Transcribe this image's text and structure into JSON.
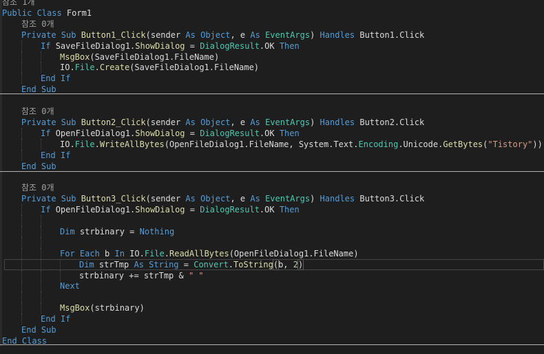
{
  "editor": {
    "theme_colors": {
      "background": "#1e1e1e",
      "plain": "#dcdcdc",
      "keyword": "#569cd6",
      "method": "#dcdcaa",
      "type": "#4ec9b0",
      "string": "#d69d85",
      "number": "#b5cea8",
      "reference_hint": "#a0a0a0"
    },
    "lines": [
      {
        "tokens": [
          {
            "t": "참조 1개",
            "c": "ref"
          }
        ]
      },
      {
        "tokens": [
          {
            "t": "Public Class ",
            "c": "kw"
          },
          {
            "t": "Form1",
            "c": "plain"
          }
        ]
      },
      {
        "tokens": [
          {
            "t": "참조 0개",
            "c": "ref"
          }
        ]
      },
      {
        "tokens": [
          {
            "t": "Private Sub ",
            "c": "kw"
          },
          {
            "t": "Button1_Click",
            "c": "method"
          },
          {
            "t": "(sender ",
            "c": "plain"
          },
          {
            "t": "As ",
            "c": "kw"
          },
          {
            "t": "Object",
            "c": "kw"
          },
          {
            "t": ", e ",
            "c": "plain"
          },
          {
            "t": "As ",
            "c": "kw"
          },
          {
            "t": "EventArgs",
            "c": "type"
          },
          {
            "t": ") ",
            "c": "plain"
          },
          {
            "t": "Handles ",
            "c": "kw"
          },
          {
            "t": "Button1.Click",
            "c": "plain"
          }
        ]
      },
      {
        "tokens": [
          {
            "t": "If ",
            "c": "kw"
          },
          {
            "t": "SaveFileDialog1.",
            "c": "plain"
          },
          {
            "t": "ShowDialog",
            "c": "method"
          },
          {
            "t": " = ",
            "c": "plain"
          },
          {
            "t": "DialogResult",
            "c": "type"
          },
          {
            "t": ".OK ",
            "c": "plain"
          },
          {
            "t": "Then",
            "c": "kw"
          }
        ]
      },
      {
        "tokens": [
          {
            "t": "MsgBox",
            "c": "method"
          },
          {
            "t": "(SaveFileDialog1.FileName)",
            "c": "plain"
          }
        ]
      },
      {
        "tokens": [
          {
            "t": "IO.",
            "c": "plain"
          },
          {
            "t": "File",
            "c": "type"
          },
          {
            "t": ".",
            "c": "plain"
          },
          {
            "t": "Create",
            "c": "method"
          },
          {
            "t": "(SaveFileDialog1.FileName)",
            "c": "plain"
          }
        ]
      },
      {
        "tokens": [
          {
            "t": "End If",
            "c": "kw"
          }
        ]
      },
      {
        "tokens": [
          {
            "t": "End Sub",
            "c": "kw"
          }
        ]
      },
      {
        "tokens": []
      },
      {
        "tokens": [
          {
            "t": "참조 0개",
            "c": "ref"
          }
        ]
      },
      {
        "tokens": [
          {
            "t": "Private Sub ",
            "c": "kw"
          },
          {
            "t": "Button2_Click",
            "c": "method"
          },
          {
            "t": "(sender ",
            "c": "plain"
          },
          {
            "t": "As ",
            "c": "kw"
          },
          {
            "t": "Object",
            "c": "kw"
          },
          {
            "t": ", e ",
            "c": "plain"
          },
          {
            "t": "As ",
            "c": "kw"
          },
          {
            "t": "EventArgs",
            "c": "type"
          },
          {
            "t": ") ",
            "c": "plain"
          },
          {
            "t": "Handles ",
            "c": "kw"
          },
          {
            "t": "Button2.Click",
            "c": "plain"
          }
        ]
      },
      {
        "tokens": [
          {
            "t": "If ",
            "c": "kw"
          },
          {
            "t": "OpenFileDialog1.",
            "c": "plain"
          },
          {
            "t": "ShowDialog",
            "c": "method"
          },
          {
            "t": " = ",
            "c": "plain"
          },
          {
            "t": "DialogResult",
            "c": "type"
          },
          {
            "t": ".OK ",
            "c": "plain"
          },
          {
            "t": "Then",
            "c": "kw"
          }
        ]
      },
      {
        "tokens": [
          {
            "t": "IO.",
            "c": "plain"
          },
          {
            "t": "File",
            "c": "type"
          },
          {
            "t": ".",
            "c": "plain"
          },
          {
            "t": "WriteAllBytes",
            "c": "method"
          },
          {
            "t": "(OpenFileDialog1.FileName, System.Text.",
            "c": "plain"
          },
          {
            "t": "Encoding",
            "c": "type"
          },
          {
            "t": ".Unicode.",
            "c": "plain"
          },
          {
            "t": "GetBytes",
            "c": "method"
          },
          {
            "t": "(",
            "c": "plain"
          },
          {
            "t": "\"Tistory\"",
            "c": "str"
          },
          {
            "t": "))",
            "c": "plain"
          }
        ]
      },
      {
        "tokens": [
          {
            "t": "End If",
            "c": "kw"
          }
        ]
      },
      {
        "tokens": [
          {
            "t": "End Sub",
            "c": "kw"
          }
        ]
      },
      {
        "tokens": []
      },
      {
        "tokens": [
          {
            "t": "참조 0개",
            "c": "ref"
          }
        ]
      },
      {
        "tokens": [
          {
            "t": "Private Sub ",
            "c": "kw"
          },
          {
            "t": "Button3_Click",
            "c": "method"
          },
          {
            "t": "(sender ",
            "c": "plain"
          },
          {
            "t": "As ",
            "c": "kw"
          },
          {
            "t": "Object",
            "c": "kw"
          },
          {
            "t": ", e ",
            "c": "plain"
          },
          {
            "t": "As ",
            "c": "kw"
          },
          {
            "t": "EventArgs",
            "c": "type"
          },
          {
            "t": ") ",
            "c": "plain"
          },
          {
            "t": "Handles ",
            "c": "kw"
          },
          {
            "t": "Button3.Click",
            "c": "plain"
          }
        ]
      },
      {
        "tokens": [
          {
            "t": "If ",
            "c": "kw"
          },
          {
            "t": "OpenFileDialog1.",
            "c": "plain"
          },
          {
            "t": "ShowDialog",
            "c": "method"
          },
          {
            "t": " = ",
            "c": "plain"
          },
          {
            "t": "DialogResult",
            "c": "type"
          },
          {
            "t": ".OK ",
            "c": "plain"
          },
          {
            "t": "Then",
            "c": "kw"
          }
        ]
      },
      {
        "tokens": []
      },
      {
        "tokens": [
          {
            "t": "Dim ",
            "c": "kw"
          },
          {
            "t": "strbinary = ",
            "c": "plain"
          },
          {
            "t": "Nothing",
            "c": "kw"
          }
        ]
      },
      {
        "tokens": []
      },
      {
        "tokens": [
          {
            "t": "For Each ",
            "c": "kw"
          },
          {
            "t": "b ",
            "c": "plain"
          },
          {
            "t": "In ",
            "c": "kw"
          },
          {
            "t": "IO.",
            "c": "plain"
          },
          {
            "t": "File",
            "c": "type"
          },
          {
            "t": ".",
            "c": "plain"
          },
          {
            "t": "ReadAllBytes",
            "c": "method"
          },
          {
            "t": "(OpenFileDialog1.FileName)",
            "c": "plain"
          }
        ]
      },
      {
        "tokens": [
          {
            "t": "Dim ",
            "c": "kw"
          },
          {
            "t": "strTmp ",
            "c": "plain"
          },
          {
            "t": "As ",
            "c": "kw"
          },
          {
            "t": "String",
            "c": "kw"
          },
          {
            "t": " = ",
            "c": "plain"
          },
          {
            "t": "Convert",
            "c": "type"
          },
          {
            "t": ".",
            "c": "plain"
          },
          {
            "t": "ToString",
            "c": "method"
          },
          {
            "t": "(",
            "c": "bracket"
          },
          {
            "t": "b, ",
            "c": "plain"
          },
          {
            "t": "2",
            "c": "num"
          },
          {
            "t": ")",
            "c": "bracket"
          }
        ]
      },
      {
        "tokens": [
          {
            "t": "strbinary += strTmp & ",
            "c": "plain"
          },
          {
            "t": "\" \"",
            "c": "str"
          }
        ]
      },
      {
        "tokens": [
          {
            "t": "Next",
            "c": "kw"
          }
        ]
      },
      {
        "tokens": []
      },
      {
        "tokens": [
          {
            "t": "MsgBox",
            "c": "method"
          },
          {
            "t": "(strbinary)",
            "c": "plain"
          }
        ]
      },
      {
        "tokens": [
          {
            "t": "End If",
            "c": "kw"
          }
        ]
      },
      {
        "tokens": [
          {
            "t": "End Sub",
            "c": "kw"
          }
        ]
      },
      {
        "tokens": [
          {
            "t": "End Class",
            "c": "kw"
          }
        ]
      }
    ]
  }
}
